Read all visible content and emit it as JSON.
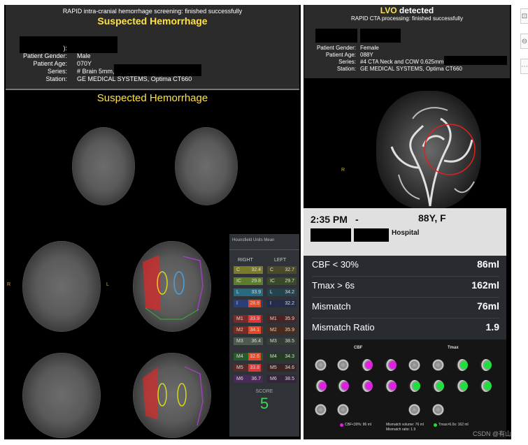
{
  "left_header": {
    "status": "RAPID intra-cranial hemorrhage screening: finished successfully",
    "title": "Suspected Hemorrhage",
    "patient_id_label": "I:",
    "patient_name_label": "):",
    "gender_label": "Patient Gender:",
    "gender": "Male",
    "age_label": "Patient Age:",
    "age": "070Y",
    "series_label": "Series:",
    "series": "# Brain 5mm,",
    "station_label": "Station:",
    "station": "GE MEDICAL SYSTEMS, Optima CT660"
  },
  "left_body": {
    "title": "Suspected Hemorrhage",
    "orient_r": "R",
    "orient_l": "L"
  },
  "hu_table": {
    "title": "Hounsfield Units Mean",
    "right_label": "RIGHT",
    "left_label": "LEFT",
    "rows": [
      {
        "r_name": "C",
        "r_val": "32.4",
        "l_name": "C",
        "l_val": "32.7"
      },
      {
        "r_name": "IC",
        "r_val": "29.8",
        "l_name": "IC",
        "l_val": "29.7"
      },
      {
        "r_name": "L",
        "r_val": "33.9",
        "l_name": "L",
        "l_val": "34.2"
      },
      {
        "r_name": "I",
        "r_val": "28.8",
        "l_name": "I",
        "l_val": "32.2"
      },
      {
        "r_name": "M1",
        "r_val": "33.9",
        "l_name": "M1",
        "l_val": "35.9"
      },
      {
        "r_name": "M2",
        "r_val": "34.1",
        "l_name": "M2",
        "l_val": "35.9"
      },
      {
        "r_name": "M3",
        "r_val": "36.4",
        "l_name": "M3",
        "l_val": "38.5"
      },
      {
        "r_name": "M4",
        "r_val": "32.6",
        "l_name": "M4",
        "l_val": "34.3"
      },
      {
        "r_name": "M5",
        "r_val": "33.8",
        "l_name": "M5",
        "l_val": "34.6"
      },
      {
        "r_name": "M6",
        "r_val": "36.7",
        "l_name": "M6",
        "l_val": "38.5"
      }
    ],
    "score_label": "SCORE",
    "score": "5",
    "colors": {
      "right": [
        "#7a7a2c",
        "#5d7d2c",
        "#2a6a80",
        "#2a3f7a",
        "#7a2a2a",
        "#7a2a1e",
        "#4d5a4d",
        "#2a5a2a",
        "#5a2a2a",
        "#4a2a5a"
      ],
      "left": [
        "#4a4a28",
        "#3a4a28",
        "#24434f",
        "#242c4a",
        "#4a2424",
        "#4a2a1a",
        "#343c34",
        "#243c24",
        "#3c2424",
        "#34243c"
      ],
      "hot": [
        "#d83a3a",
        "#e04a28"
      ]
    }
  },
  "right_header": {
    "title_accent": "LVO",
    "title_rest": "detected",
    "status": "RAPID CTA processing: finished successfully",
    "gender_label": "Patient Gender:",
    "gender": "Female",
    "age_label": "Patient Age:",
    "age": "088Y",
    "series_label": "Series:",
    "series": "#4 CTA Neck and COW 0.625mm,",
    "station_label": "Station:",
    "station": "GE MEDICAL SYSTEMS, Optima CT660",
    "orient_r": "R"
  },
  "perfusion": {
    "time": "2:35 PM",
    "dash": "-",
    "patient": "88Y, F",
    "hospital": "Hospital",
    "rows": [
      {
        "label": "CBF < 30%",
        "value": "86ml"
      },
      {
        "label": "Tmax > 6s",
        "value": "162ml"
      },
      {
        "label": "Mismatch",
        "value": "76ml"
      },
      {
        "label": "Mismatch Ratio",
        "value": "1.9"
      }
    ],
    "cbf_label": "CBF",
    "tmax_label": "Tmax",
    "legend_cbf": "CBF<30%: 86 ml",
    "legend_mismatch_volume": "Mismatch volume: 76 ml",
    "legend_mismatch_ratio": "Mismatch ratio: 1.9",
    "legend_tmax": "Tmax>6.0s: 162 ml",
    "colors": {
      "cbf": "#e020e0",
      "tmax": "#20e040"
    }
  },
  "watermark": "CSDN @有山"
}
